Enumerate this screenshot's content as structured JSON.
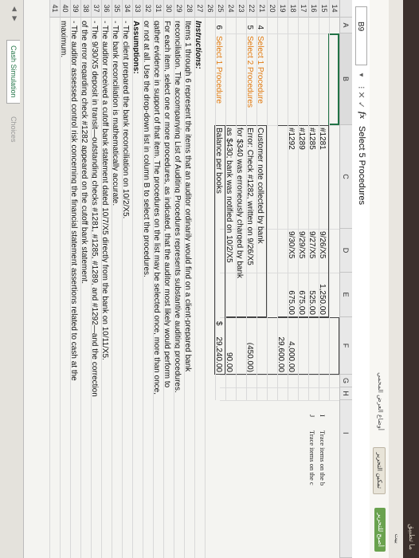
{
  "window": {
    "close_glyph": "✕",
    "top_text": "ما تطبيق",
    "arabic_bar_text": "بيت",
    "ribbon_pill_1": "أصبح للتحرير",
    "ribbon_pill_2": "تمكين التحرير",
    "ribbon_text": "أوضاع العرض المحمي"
  },
  "formula_bar": {
    "name_box": "B9",
    "fx_label": "fx",
    "content": "Select 5 Procedures"
  },
  "columns": [
    "A",
    "B",
    "C",
    "D",
    "E",
    "F",
    "G",
    "H",
    "I"
  ],
  "rows": {
    "r14": {
      "num": "14"
    },
    "r15": {
      "num": "15",
      "c": "#1281",
      "d": "9/26/X5",
      "e": "1,250.00"
    },
    "r16": {
      "num": "16",
      "c": "#1285",
      "d": "9/27/X5",
      "e": "525.00"
    },
    "r17": {
      "num": "17",
      "c": "#1289",
      "d": "9/29/X5",
      "e": "675.00"
    },
    "r18": {
      "num": "18",
      "c": "#1292",
      "d": "9/30/X5",
      "e": "675.00",
      "f": "4,000.00"
    },
    "r19": {
      "num": "19",
      "f": "29,600.00"
    },
    "r20": {
      "num": "20",
      "a": "4",
      "b": "Select 1 Procedure",
      "c": "Customer note collected by bank"
    },
    "r21": {
      "num": "21",
      "a": "5",
      "b": "Select 2 Procedures",
      "c": "Error: Check #1282, written on 9/26/X5",
      "f": "(450.00)"
    },
    "r22": {
      "num": "22",
      "c": "for $340 was erroneously charged by bank"
    },
    "r23": {
      "num": "23",
      "c": "as $430; bank was notified on 10/2/X5",
      "f": "90.00"
    },
    "r24": {
      "num": "24",
      "a": "6",
      "b": "Select 1 Procedure",
      "c": "Balance per books",
      "f_sym": "$",
      "f": "29,240.00"
    },
    "r25": {
      "num": "25"
    },
    "r26": {
      "num": "26",
      "text": "Instructions:"
    },
    "r27": {
      "num": "27",
      "text": "Items 1 through 6 represent the items that an auditor ordinarily would find on a client-prepared bank"
    },
    "r28": {
      "num": "28",
      "text": "reconciliation. The accompanying List of Auditing Procedures represents substantive auditing procedures."
    },
    "r29": {
      "num": "29",
      "text": "For each item, select one or more procedures, as indicated, that the auditor most likely would perform to"
    },
    "r30": {
      "num": "30",
      "text": "gather evidence in support of that item. The procedures on the list may be selected once, more than once,"
    },
    "r31": {
      "num": "31",
      "text": "or not at all. Use the drop-down list in column B to select the procedures."
    },
    "r32": {
      "num": "32",
      "text": "Assumptions:"
    },
    "r33": {
      "num": "33",
      "text": "- The client prepared the bank reconciliation on 10/2/X5."
    },
    "r34": {
      "num": "34",
      "text": "- The bank reconciliation is mathematically accurate."
    },
    "r35": {
      "num": "35",
      "text": "- The auditor received a cutoff bank statement dated 10/7/X5 directly from the bank on 10/11/X5."
    },
    "r36": {
      "num": "36",
      "text": "- The 9/30/X5 deposit in transit—outstanding checks #1281, #1285, #1289, and #1292—and the correction"
    },
    "r37": {
      "num": "37",
      "text": "  of the error regarding check #1282 appeared on the cutoff bank statement."
    },
    "r38": {
      "num": "38",
      "text": "- The auditor assessed control risk concerning the financial statement assertions related to cash at the"
    },
    "r39": {
      "num": "39",
      "text": "  maximum."
    },
    "r40": {
      "num": "40"
    },
    "r41": {
      "num": "41"
    }
  },
  "side_notes": {
    "i_letter": "I",
    "j_letter": "J",
    "trace1": "Trace items on the b",
    "trace2": "Trace items on the c"
  },
  "tabs": {
    "nav": "◀ ▶",
    "active": "Cash Simulation",
    "inactive": "Choices"
  },
  "colors": {
    "accent": "#217346",
    "procedure_link": "#e07a10"
  }
}
